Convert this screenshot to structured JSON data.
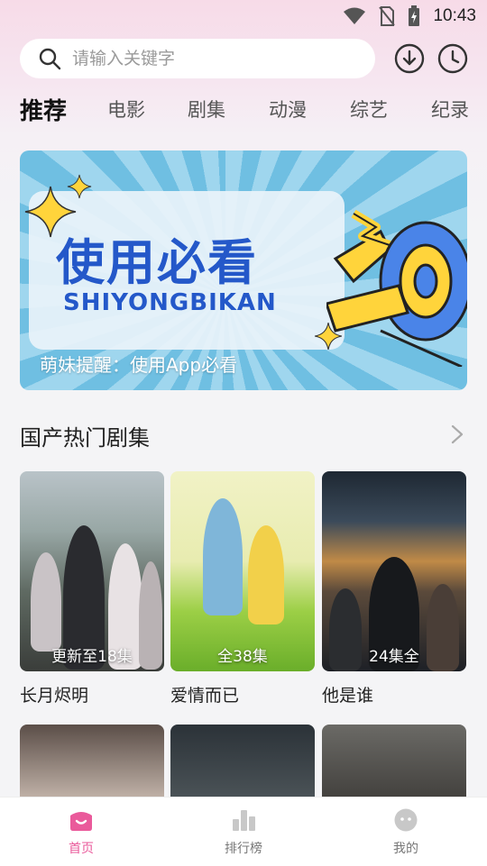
{
  "status_bar": {
    "time": "10:43"
  },
  "search": {
    "placeholder": "请输入关键字"
  },
  "tabs": [
    {
      "label": "推荐",
      "active": true
    },
    {
      "label": "电影"
    },
    {
      "label": "剧集"
    },
    {
      "label": "动漫"
    },
    {
      "label": "综艺"
    },
    {
      "label": "纪录"
    }
  ],
  "banner": {
    "title": "使用必看",
    "subtitle": "SHIYONGBIKAN",
    "caption": "萌妹提醒：使用App必看"
  },
  "section": {
    "title": "国产热门剧集"
  },
  "shows": [
    {
      "title": "长月烬明",
      "badge": "更新至18集"
    },
    {
      "title": "爱情而已",
      "badge": "全38集"
    },
    {
      "title": "他是谁",
      "badge": "24集全"
    }
  ],
  "bottom_nav": [
    {
      "label": "首页",
      "icon": "home-icon",
      "active": true
    },
    {
      "label": "排行榜",
      "icon": "ranking-icon"
    },
    {
      "label": "我的",
      "icon": "profile-icon"
    }
  ],
  "colors": {
    "accent": "#ea5a9b",
    "banner_text": "#2458c9"
  }
}
